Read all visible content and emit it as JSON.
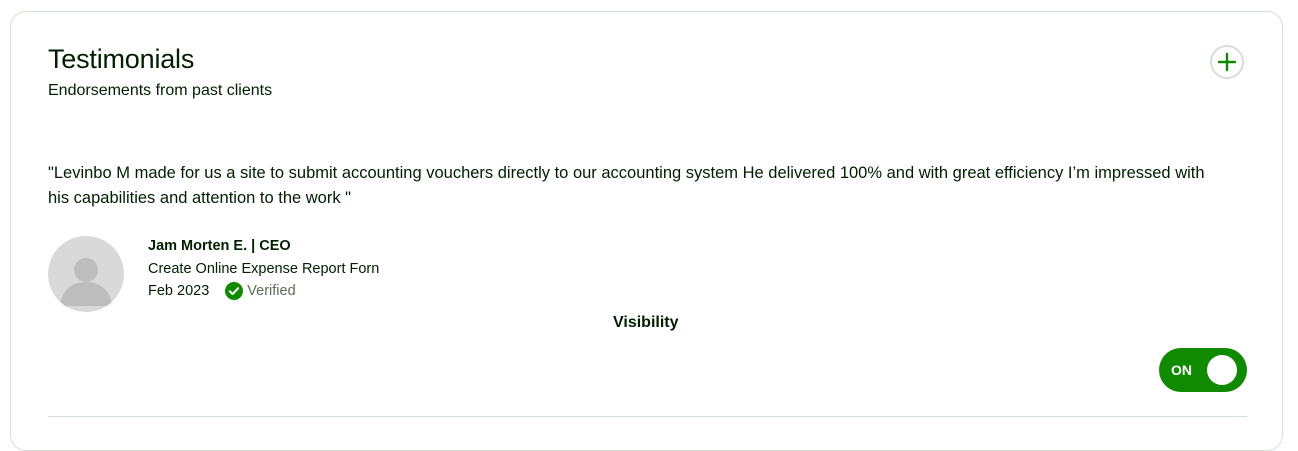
{
  "header": {
    "title": "Testimonials",
    "subtitle": "Endorsements from past clients",
    "add_icon": "plus-icon"
  },
  "testimonial": {
    "quote": "\"Levinbo M made for us a site to submit accounting vouchers directly to our accounting system He delivered 100% and with great efficiency I’m impressed with his capabilities and attention to the work \"",
    "client_name": "Jam Morten E. | CEO",
    "project": "Create Online Expense Report Forn",
    "date": "Feb 2023",
    "verified_label": "Verified",
    "avatar_icon": "default-avatar-icon",
    "verified_icon": "check-circle-icon"
  },
  "visibility": {
    "label": "Visibility",
    "toggle_text": "ON",
    "enabled": true
  },
  "colors": {
    "accent_green": "#108a00",
    "border": "#d5e0d5",
    "text": "#001e00",
    "muted": "#5e6d55"
  }
}
